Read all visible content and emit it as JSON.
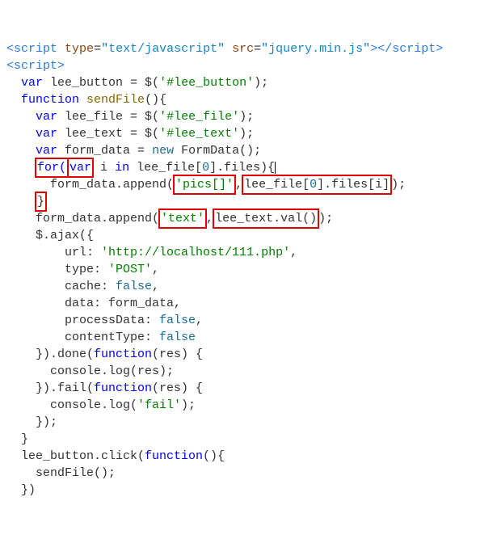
{
  "code": {
    "l1_open": "<",
    "l1_tag": "script",
    "l1_sp": " ",
    "l1_attr1": "type",
    "l1_eq": "=",
    "l1_val1": "\"text/javascript\"",
    "l1_sp2": " ",
    "l1_attr2": "src",
    "l1_val2": "\"jquery.min.js\"",
    "l1_gt": ">",
    "l1_close": "</",
    "l1_closetag": "script",
    "l1_closegt": ">",
    "l2_open": "<",
    "l2_tag": "script",
    "l2_gt": ">",
    "l3_indent": "  ",
    "l3_kw": "var",
    "l3_rest": " lee_button = $(",
    "l3_str": "'#lee_button'",
    "l3_end": ");",
    "l4_indent": "  ",
    "l4_kw": "function",
    "l4_sp": " ",
    "l4_name": "sendFile",
    "l4_rest": "(){",
    "l5_indent": "    ",
    "l5_kw": "var",
    "l5_rest": " lee_file = $(",
    "l5_str": "'#lee_file'",
    "l5_end": ");",
    "l6_indent": "    ",
    "l6_kw": "var",
    "l6_rest": " lee_text = $(",
    "l6_str": "'#lee_text'",
    "l6_end": ");",
    "l7_indent": "    ",
    "l7_kw": "var",
    "l7_rest": " form_data = ",
    "l7_new": "new",
    "l7_rest2": " FormData();",
    "l8_indent": "    ",
    "l8_for_box": "for(",
    "l8_var_box": "var",
    "l8_rest": " i ",
    "l8_in": "in",
    "l8_rest2": " lee_file[",
    "l8_zero1": "0",
    "l8_rest3": "].files){",
    "l9_indent": "      form_data.append(",
    "l9_pics_box": "'pics[]'",
    "l9_comma": ",",
    "l9_files_box_a": "lee_file[",
    "l9_files_box_zero": "0",
    "l9_files_box_b": "].files[i]",
    "l9_end": ");",
    "l10_indent": "    ",
    "l10_brace": "}",
    "l11_indent": "    form_data.append(",
    "l11_text_box": "'text'",
    "l11_comma": ",",
    "l11_val_box": "lee_text.val()",
    "l11_end": ");",
    "l12": "    $.ajax({",
    "l13_indent": "        url: ",
    "l13_str": "'http://localhost/111.php'",
    "l13_end": ",",
    "l14_indent": "        type: ",
    "l14_str": "'POST'",
    "l14_end": ",",
    "l15_indent": "        cache: ",
    "l15_lit": "false",
    "l15_end": ",",
    "l16": "        data: form_data,",
    "l17_indent": "        processData: ",
    "l17_lit": "false",
    "l17_end": ",",
    "l18_indent": "        contentType: ",
    "l18_lit": "false",
    "l19_indent": "    }).done(",
    "l19_kw": "function",
    "l19_rest": "(res) {",
    "l20": "      console.log(res);",
    "l21_indent": "    }).fail(",
    "l21_kw": "function",
    "l21_rest": "(res) {",
    "l22_indent": "      console.log(",
    "l22_str": "'fail'",
    "l22_end": ");",
    "l23": "    });",
    "l24": "  }",
    "l25_indent": "  lee_button.click(",
    "l25_kw": "function",
    "l25_rest": "(){",
    "l26": "    sendFile();",
    "l27": "  })"
  }
}
